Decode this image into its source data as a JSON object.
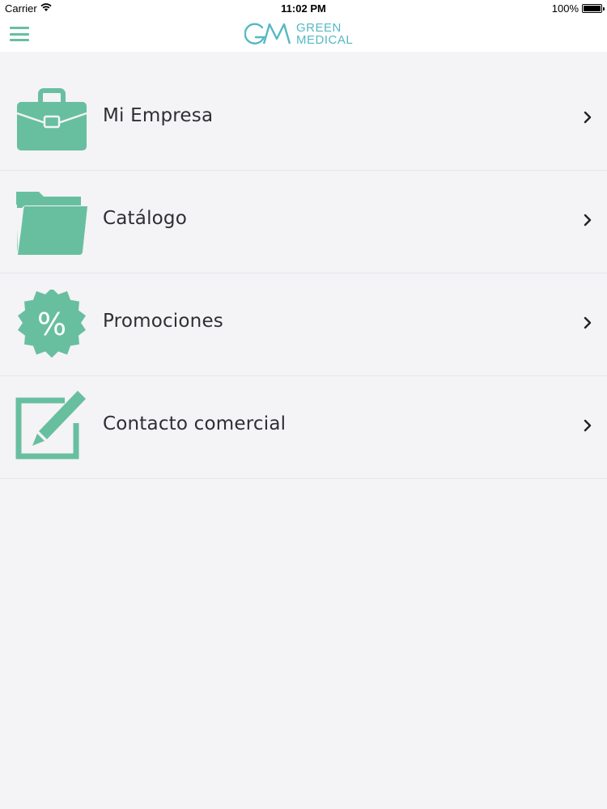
{
  "status_bar": {
    "carrier": "Carrier",
    "time": "11:02 PM",
    "battery": "100%"
  },
  "nav": {
    "logo_monogram": "GM",
    "logo_line1": "GREEN",
    "logo_line2": "MEDICAL",
    "menu_icon": "hamburger-menu-icon"
  },
  "colors": {
    "accent": "#68bfa0",
    "logo": "#56b8c4",
    "background": "#f4f3f6",
    "text": "#2f2f33"
  },
  "menu": {
    "items": [
      {
        "label": "Mi Empresa",
        "icon": "briefcase-icon"
      },
      {
        "label": "Catálogo",
        "icon": "folder-icon"
      },
      {
        "label": "Promociones",
        "icon": "percent-badge-icon"
      },
      {
        "label": "Contacto comercial",
        "icon": "edit-note-icon"
      }
    ]
  }
}
